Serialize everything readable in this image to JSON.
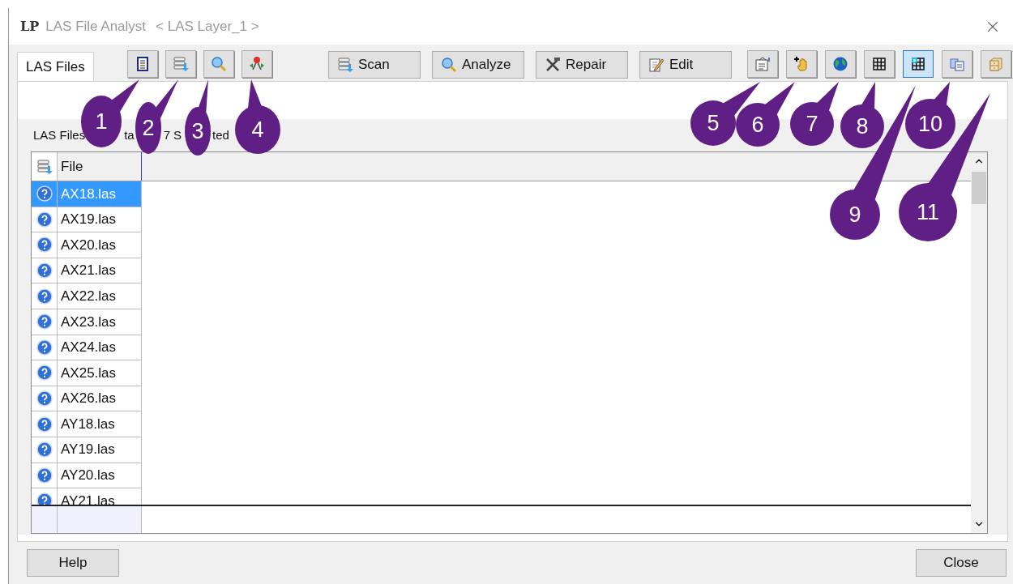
{
  "window": {
    "title": "LAS File Analyst",
    "subtitle": "< LAS Layer_1 >",
    "logo": "LP"
  },
  "tabs": [
    {
      "label": "LAS Files",
      "selected": true
    }
  ],
  "toolbar_left": [
    {
      "kind": "list",
      "selected": false
    },
    {
      "kind": "scan",
      "selected": false
    },
    {
      "kind": "search",
      "selected": false
    },
    {
      "kind": "split",
      "selected": false
    }
  ],
  "toolbar_text": [
    {
      "kind": "scan",
      "label": "Scan"
    },
    {
      "kind": "search",
      "label": "Analyze"
    },
    {
      "kind": "tools",
      "label": "Repair"
    },
    {
      "kind": "edit",
      "label": "Edit"
    }
  ],
  "toolbar_right": [
    {
      "kind": "properties",
      "selected": false
    },
    {
      "kind": "hand",
      "selected": false
    },
    {
      "kind": "globe",
      "selected": false
    },
    {
      "kind": "grid",
      "selected": false
    },
    {
      "kind": "grid-mark",
      "selected": true
    },
    {
      "kind": "copy",
      "selected": false
    },
    {
      "kind": "cabinet",
      "selected": false
    }
  ],
  "status": [
    "LAS Files",
    "ta",
    "7",
    "S",
    "ted"
  ],
  "table": {
    "columns": [
      "File"
    ],
    "rows": [
      {
        "file": "AX18.las",
        "selected": true
      },
      {
        "file": "AX19.las",
        "selected": false
      },
      {
        "file": "AX20.las",
        "selected": false
      },
      {
        "file": "AX21.las",
        "selected": false
      },
      {
        "file": "AX22.las",
        "selected": false
      },
      {
        "file": "AX23.las",
        "selected": false
      },
      {
        "file": "AX24.las",
        "selected": false
      },
      {
        "file": "AX25.las",
        "selected": false
      },
      {
        "file": "AX26.las",
        "selected": false
      },
      {
        "file": "AY18.las",
        "selected": false
      },
      {
        "file": "AY19.las",
        "selected": false
      },
      {
        "file": "AY20.las",
        "selected": false
      },
      {
        "file": "AY21.las",
        "selected": false
      }
    ]
  },
  "buttons": [
    "Help",
    "Close"
  ],
  "callouts": [
    "1",
    "2",
    "3",
    "4",
    "5",
    "6",
    "7",
    "8",
    "9",
    "10",
    "11"
  ]
}
